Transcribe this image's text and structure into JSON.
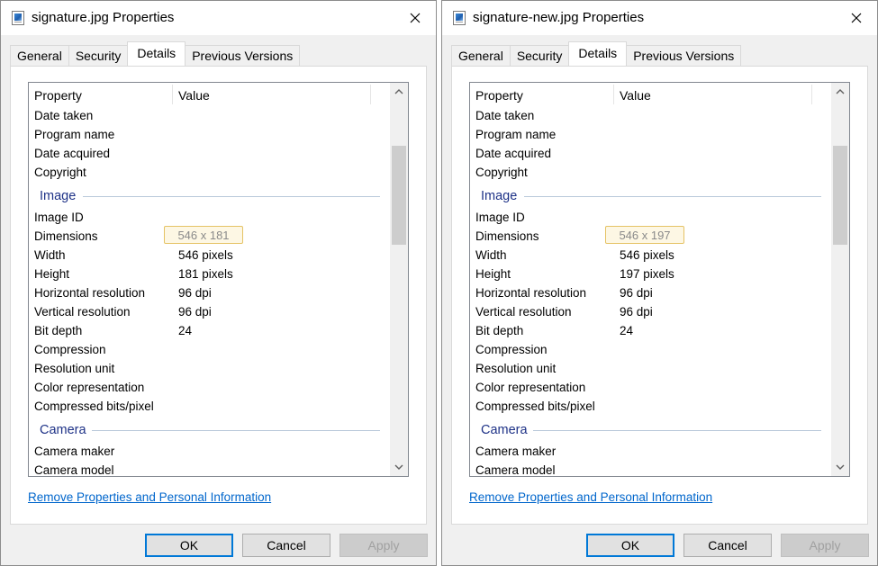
{
  "dialogs": [
    {
      "title": "signature.jpg Properties",
      "tabs": [
        "General",
        "Security",
        "Details",
        "Previous Versions"
      ],
      "active_tab": "Details",
      "columns": {
        "property": "Property",
        "value": "Value"
      },
      "rows_top": [
        "Date taken",
        "Program name",
        "Date acquired",
        "Copyright"
      ],
      "groups": [
        {
          "name": "Image",
          "rows": [
            {
              "p": "Image ID",
              "v": ""
            },
            {
              "p": "Dimensions",
              "v": "546 x 181"
            },
            {
              "p": "Width",
              "v": "546 pixels"
            },
            {
              "p": "Height",
              "v": "181 pixels"
            },
            {
              "p": "Horizontal resolution",
              "v": "96 dpi"
            },
            {
              "p": "Vertical resolution",
              "v": "96 dpi"
            },
            {
              "p": "Bit depth",
              "v": "24"
            },
            {
              "p": "Compression",
              "v": ""
            },
            {
              "p": "Resolution unit",
              "v": ""
            },
            {
              "p": "Color representation",
              "v": ""
            },
            {
              "p": "Compressed bits/pixel",
              "v": ""
            }
          ]
        },
        {
          "name": "Camera",
          "rows": [
            {
              "p": "Camera maker",
              "v": ""
            },
            {
              "p": "Camera model",
              "v": ""
            }
          ]
        }
      ],
      "link": "Remove Properties and Personal Information",
      "buttons": {
        "ok": "OK",
        "cancel": "Cancel",
        "apply": "Apply"
      }
    },
    {
      "title": "signature-new.jpg Properties",
      "tabs": [
        "General",
        "Security",
        "Details",
        "Previous Versions"
      ],
      "active_tab": "Details",
      "columns": {
        "property": "Property",
        "value": "Value"
      },
      "rows_top": [
        "Date taken",
        "Program name",
        "Date acquired",
        "Copyright"
      ],
      "groups": [
        {
          "name": "Image",
          "rows": [
            {
              "p": "Image ID",
              "v": ""
            },
            {
              "p": "Dimensions",
              "v": "546 x 197"
            },
            {
              "p": "Width",
              "v": "546 pixels"
            },
            {
              "p": "Height",
              "v": "197 pixels"
            },
            {
              "p": "Horizontal resolution",
              "v": "96 dpi"
            },
            {
              "p": "Vertical resolution",
              "v": "96 dpi"
            },
            {
              "p": "Bit depth",
              "v": "24"
            },
            {
              "p": "Compression",
              "v": ""
            },
            {
              "p": "Resolution unit",
              "v": ""
            },
            {
              "p": "Color representation",
              "v": ""
            },
            {
              "p": "Compressed bits/pixel",
              "v": ""
            }
          ]
        },
        {
          "name": "Camera",
          "rows": [
            {
              "p": "Camera maker",
              "v": ""
            },
            {
              "p": "Camera model",
              "v": ""
            }
          ]
        }
      ],
      "link": "Remove Properties and Personal Information",
      "buttons": {
        "ok": "OK",
        "cancel": "Cancel",
        "apply": "Apply"
      }
    }
  ],
  "icons": {
    "title": "image-file-icon",
    "close": "close-icon",
    "scroll_up": "scroll-up-arrow-icon",
    "scroll_down": "scroll-down-arrow-icon"
  },
  "colors": {
    "group_heading": "#1e3287",
    "link": "#0066cc",
    "default_button_border": "#0078d7",
    "dimension_highlight": "#fdf7e4"
  }
}
